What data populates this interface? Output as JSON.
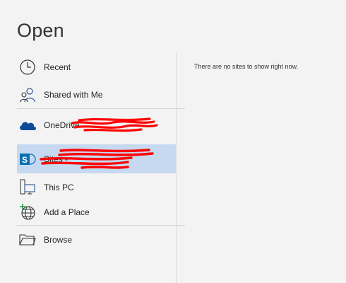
{
  "title": "Open",
  "locations": [
    {
      "label": "Recent",
      "icon": "clock-icon"
    },
    {
      "label": "Shared with Me",
      "icon": "people-icon"
    },
    {
      "label": "OneDrive -",
      "icon": "onedrive-icon"
    },
    {
      "label": "Sites -",
      "icon": "sharepoint-icon",
      "selected": true
    },
    {
      "label": "This PC",
      "icon": "pc-icon"
    },
    {
      "label": "Add a Place",
      "icon": "add-globe-icon"
    },
    {
      "label": "Browse",
      "icon": "folder-icon"
    }
  ],
  "right_panel": {
    "message": "There are no sites to show right now."
  },
  "colors": {
    "background": "#f3f3f3",
    "selection": "#c6d9f0",
    "onedrive_blue": "#0f4a97",
    "sharepoint_blue": "#0c6fb3",
    "redaction": "#ff0000"
  }
}
